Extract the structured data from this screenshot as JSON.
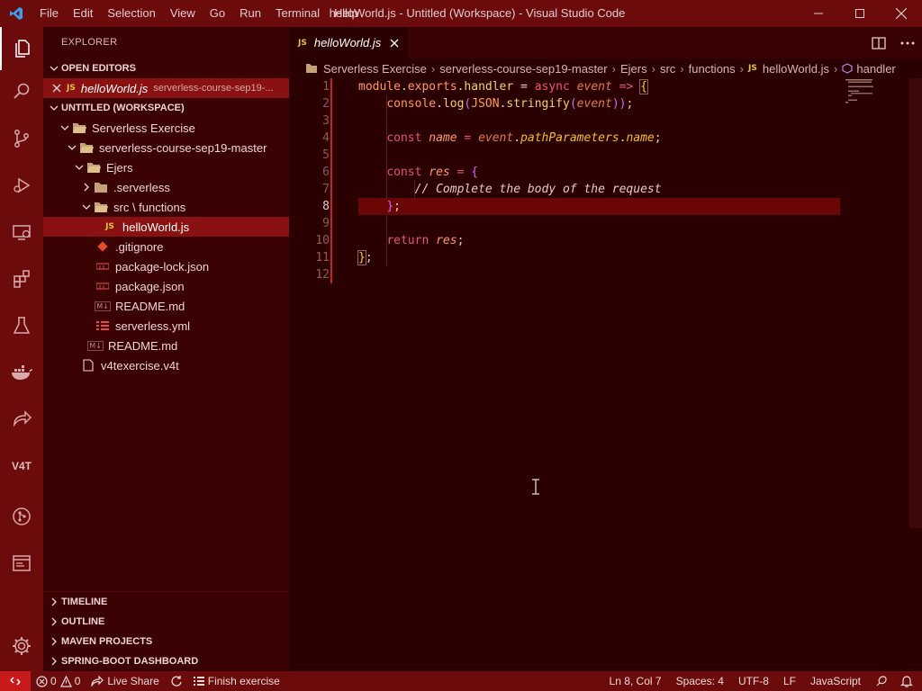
{
  "window": {
    "title": "helloWorld.js - Untitled (Workspace) - Visual Studio Code",
    "menus": [
      "File",
      "Edit",
      "Selection",
      "View",
      "Go",
      "Run",
      "Terminal",
      "Help"
    ]
  },
  "activity_bar": {
    "items": [
      "explorer-icon",
      "search-icon",
      "source-control-icon",
      "run-debug-icon",
      "remote-explorer-icon",
      "extensions-icon",
      "testing-icon",
      "docker-icon",
      "live-share-icon",
      "v4t-icon",
      "gitlens-icon",
      "terminal-panel-icon",
      "settings-gear-icon"
    ],
    "v4t_label": "V4T"
  },
  "sidebar": {
    "title": "EXPLORER",
    "open_editors": {
      "label": "OPEN EDITORS",
      "items": [
        {
          "badge": "JS",
          "name": "helloWorld.js",
          "description": "serverless-course-sep19-..."
        }
      ]
    },
    "workspace": {
      "label": "UNTITLED (WORKSPACE)",
      "tree": {
        "root": "Serverless Exercise",
        "project": "serverless-course-sep19-master",
        "folder": "Ejers",
        "serverless_folder": ".serverless",
        "src_folder": "src \\ functions",
        "active_file": "helloWorld.js",
        "gitignore": ".gitignore",
        "package_lock": "package-lock.json",
        "package": "package.json",
        "readme_inner": "README.md",
        "serverless_yml": "serverless.yml",
        "readme_outer": "README.md",
        "v4t": "v4texercise.v4t"
      },
      "badges": {
        "js": "JS",
        "md": "M↓"
      }
    },
    "bottom_sections": [
      "TIMELINE",
      "OUTLINE",
      "MAVEN PROJECTS",
      "SPRING-BOOT DASHBOARD"
    ]
  },
  "editor": {
    "tab": {
      "badge": "JS",
      "label": "helloWorld.js"
    },
    "breadcrumbs": [
      "Serverless Exercise",
      "serverless-course-sep19-master",
      "Ejers",
      "src",
      "functions",
      "helloWorld.js",
      "handler"
    ],
    "breadcrumb_badge": "JS",
    "line_numbers": [
      "1",
      "2",
      "3",
      "4",
      "5",
      "6",
      "7",
      "8",
      "9",
      "10",
      "11",
      "12"
    ],
    "current_line": 8,
    "code": {
      "l1": {
        "a": "module",
        "b": ".",
        "c": "exports",
        "d": ".",
        "e": "handler",
        "f": " = ",
        "g": "async",
        "h": " ",
        "i": "event",
        "j": " => ",
        "k": "{"
      },
      "l2": {
        "a": "console",
        "b": ".",
        "c": "log",
        "d": "(",
        "e": "JSON",
        "f": ".",
        "g": "stringify",
        "h": "(",
        "i": "event",
        "j": "))",
        "k": ";"
      },
      "l4": {
        "a": "const",
        "b": " ",
        "c": "name",
        "d": " = ",
        "e": "event",
        "f": ".",
        "g": "pathParameters",
        "h": ".",
        "i": "name",
        "j": ";"
      },
      "l6": {
        "a": "const",
        "b": " ",
        "c": "res",
        "d": " = ",
        "e": "{"
      },
      "l7": {
        "a": "// Complete the body of the request"
      },
      "l8": {
        "a": "}",
        "b": ";"
      },
      "l10": {
        "a": "return",
        "b": " ",
        "c": "res",
        "d": ";"
      },
      "l11": {
        "a": "}",
        "b": ";"
      }
    }
  },
  "status_bar": {
    "errors": "0",
    "warnings": "0",
    "live_share": "Live Share",
    "finish_exercise": "Finish exercise",
    "position": "Ln 8, Col 7",
    "spaces": "Spaces: 4",
    "encoding": "UTF-8",
    "eol": "LF",
    "language": "JavaScript"
  },
  "colors": {
    "title_bar": "#6b0b0b",
    "sidebar": "#3a0202",
    "editor": "#2b0000",
    "selection": "#8a1111",
    "remote_button": "#c81a1a"
  }
}
